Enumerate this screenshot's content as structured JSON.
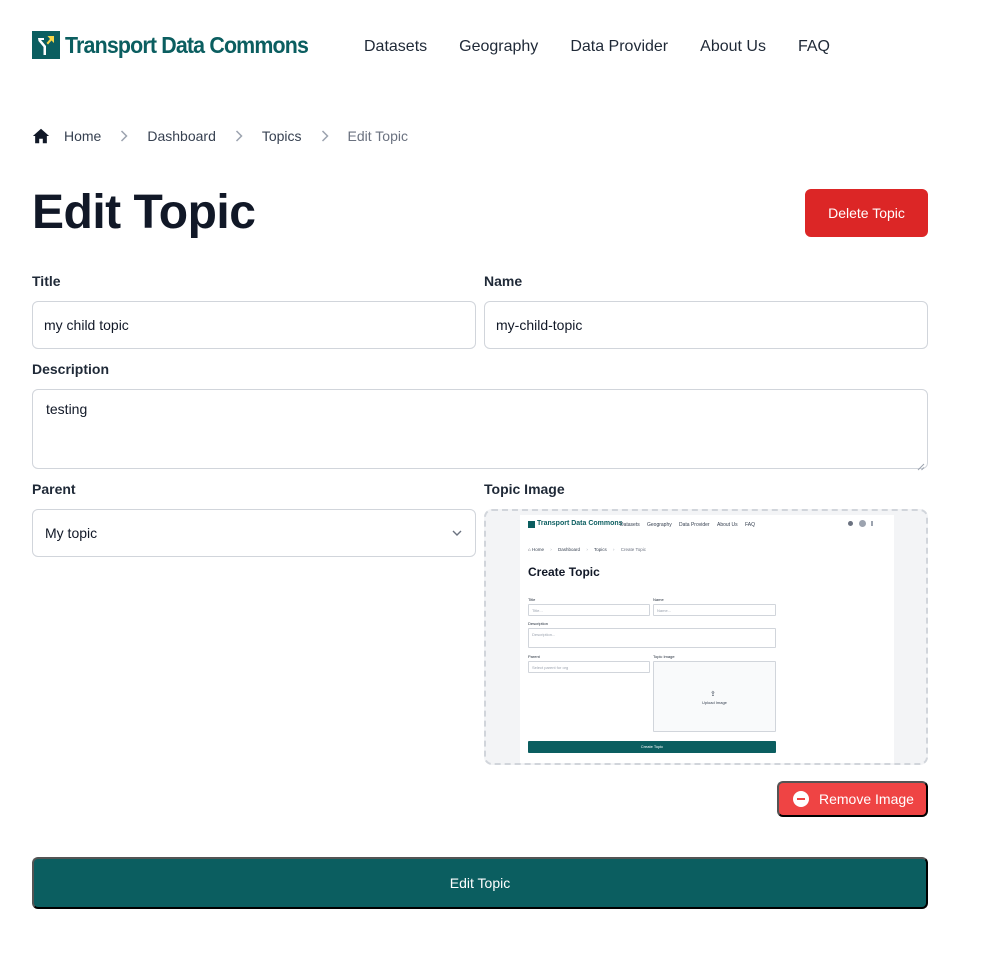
{
  "brand": {
    "name": "Transport Data Commons",
    "color": "#0b5e60"
  },
  "nav": [
    "Datasets",
    "Geography",
    "Data Provider",
    "About Us",
    "FAQ"
  ],
  "breadcrumb": {
    "home": "Home",
    "items": [
      "Dashboard",
      "Topics"
    ],
    "current": "Edit Topic"
  },
  "page": {
    "title": "Edit Topic",
    "delete_label": "Delete Topic"
  },
  "form": {
    "title_label": "Title",
    "title_value": "my child topic",
    "name_label": "Name",
    "name_value": "my-child-topic",
    "description_label": "Description",
    "description_value": "testing",
    "parent_label": "Parent",
    "parent_value": "My topic",
    "image_label": "Topic Image",
    "remove_image_label": "Remove Image",
    "submit_label": "Edit Topic"
  },
  "thumbnail": {
    "brand": "Transport Data Commons",
    "nav": [
      "Datasets",
      "Geography",
      "Data Provider",
      "About Us",
      "FAQ"
    ],
    "breadcrumb": [
      "Home",
      "Dashboard",
      "Topics",
      "Create Topic"
    ],
    "title": "Create Topic",
    "title_label": "Title",
    "title_placeholder": "Title...",
    "name_label": "Name",
    "name_placeholder": "Name...",
    "description_label": "Description",
    "description_placeholder": "Description...",
    "parent_label": "Parent",
    "parent_placeholder": "Select parent for org",
    "image_label": "Topic Image",
    "upload_label": "Upload Image",
    "submit_label": "Create Topic"
  },
  "colors": {
    "danger": "#dc2626",
    "danger_light": "#ef4444",
    "primary": "#0b5e60"
  }
}
